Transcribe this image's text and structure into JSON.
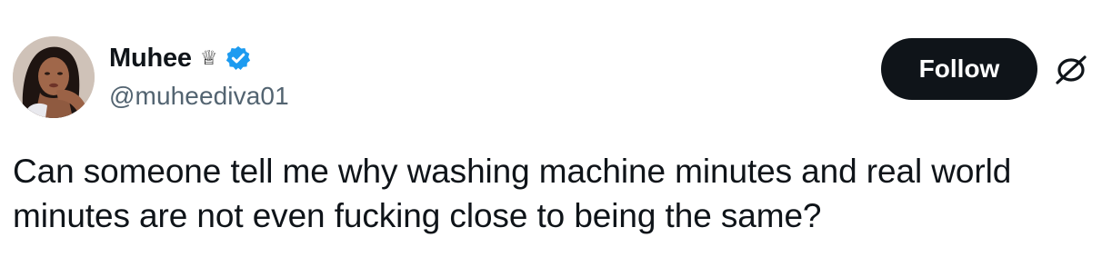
{
  "tweet": {
    "author": {
      "display_name": "Muhee",
      "handle": "@muheediva01",
      "badge_icon": "crown-icon",
      "verified_icon": "verified-badge-icon",
      "verified_color": "#1d9bf0"
    },
    "follow_label": "Follow",
    "brand_icon": "x-logo-icon",
    "text": "Can someone tell me why washing machine minutes and real world minutes are not even fucking close to being the same?"
  },
  "colors": {
    "primary_text": "#0f1419",
    "secondary_text": "#536471",
    "button_bg": "#0f1419",
    "button_text": "#ffffff"
  }
}
